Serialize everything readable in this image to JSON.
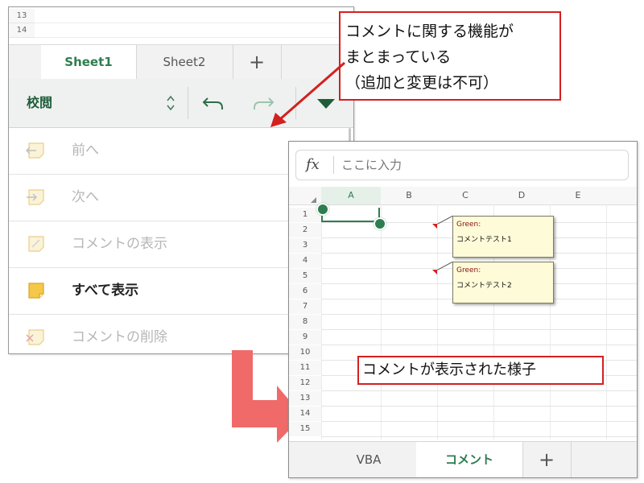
{
  "left_panel": {
    "row_numbers": [
      "13",
      "14"
    ],
    "tabs": [
      {
        "label": "Sheet1",
        "active": true
      },
      {
        "label": "Sheet2",
        "active": false
      },
      {
        "label": "+",
        "active": false
      }
    ],
    "ribbon": {
      "title": "校閲",
      "updown_icon": "chevron-up-down-icon",
      "undo_icon": "undo-icon",
      "redo_icon": "redo-icon",
      "collapse_icon": "triangle-down-icon",
      "accent_color": "#1f5c3a"
    },
    "menu": [
      {
        "label": "前へ",
        "icon": "previous-comment-icon",
        "enabled": false
      },
      {
        "label": "次へ",
        "icon": "next-comment-icon",
        "enabled": false
      },
      {
        "label": "コメントの表示",
        "icon": "show-comment-icon",
        "enabled": false
      },
      {
        "label": "すべて表示",
        "icon": "show-all-comments-icon",
        "enabled": true
      },
      {
        "label": "コメントの削除",
        "icon": "delete-comment-icon",
        "enabled": false
      }
    ]
  },
  "callout_top": {
    "lines": [
      "コメントに関する機能が",
      "まとまっている",
      "（追加と変更は不可）"
    ],
    "border_color": "#d32020"
  },
  "right_panel": {
    "formula_bar": {
      "fx_label": "fx",
      "placeholder": "ここに入力"
    },
    "columns": [
      "A",
      "B",
      "C",
      "D",
      "E"
    ],
    "selected_column": "A",
    "rows": [
      "1",
      "2",
      "3",
      "4",
      "5",
      "6",
      "7",
      "8",
      "9",
      "10",
      "11",
      "12",
      "13",
      "14",
      "15"
    ],
    "comments": [
      {
        "author": "Green:",
        "text": "コメントテスト1"
      },
      {
        "author": "Green:",
        "text": "コメントテスト2"
      }
    ],
    "callout": {
      "text": "コメントが表示された様子"
    },
    "tabs": [
      {
        "label": "VBA",
        "active": false
      },
      {
        "label": "コメント",
        "active": true
      },
      {
        "label": "+",
        "active": false
      }
    ],
    "accent_color": "#2e7d4f",
    "comment_marker_color": "#d42020"
  },
  "arrows": {
    "annotation_color": "#d32020",
    "transition_color": "#f06a6a"
  }
}
